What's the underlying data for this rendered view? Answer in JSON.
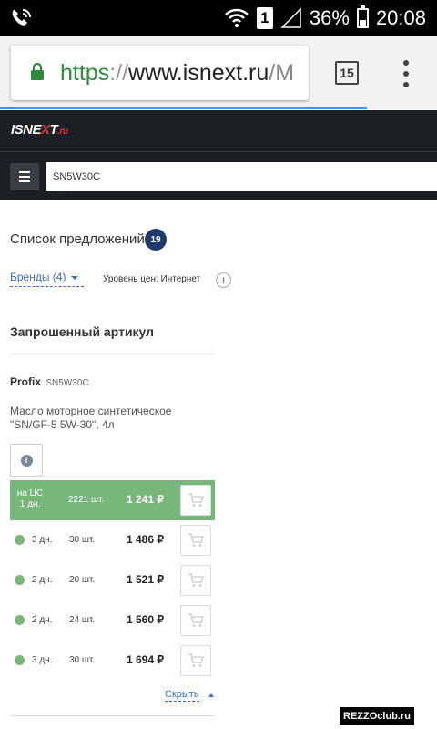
{
  "status_bar": {
    "battery": "36%",
    "time": "20:08",
    "sim_slot": "1",
    "battery_level": 0.36,
    "icons": [
      "phone-wifi-icon",
      "wifi-icon",
      "sim-icon",
      "signal-icon",
      "battery-icon"
    ]
  },
  "browser": {
    "url_scheme": "https",
    "url_separator": "://",
    "url_host": "www.isnext.ru",
    "url_path": "/M",
    "tab_count": "15",
    "accent": "#4a90e2",
    "page_load_progress": 0.84
  },
  "site": {
    "logo_prefix": "ISNE",
    "logo_x": "X",
    "logo_suffix": "T",
    "logo_domain": ".ru",
    "search_value": "SN5W30C"
  },
  "offers": {
    "title": "Список предложений",
    "count": "19",
    "brands_label": "Бренды (4)",
    "price_level": "Уровень цен: Интернет",
    "price_level_info": "!"
  },
  "requested": {
    "title": "Запрошенный артикул",
    "brand": "Profix",
    "article": "SN5W30C",
    "description_line1": "Масло моторное синтетическое",
    "description_line2": "\"SN/GF-5 5W-30\", 4л"
  },
  "rows": [
    {
      "loc_line1": "на ЦС",
      "loc_line2": "1 дн.",
      "qty": "2221 шт.",
      "price": "1 241 ₽"
    },
    {
      "days": "3 дн.",
      "qty": "30 шт.",
      "price": "1 486 ₽"
    },
    {
      "days": "2 дн.",
      "qty": "20 шт.",
      "price": "1 521 ₽"
    },
    {
      "days": "2 дн.",
      "qty": "24 шт.",
      "price": "1 560 ₽"
    },
    {
      "days": "3 дн.",
      "qty": "30 шт.",
      "price": "1 694 ₽"
    }
  ],
  "hide_label": "Скрыть",
  "watermark": "REZZOclub.ru",
  "colors": {
    "header_bg": "#1c1f24",
    "highlight_row": "#77b77a",
    "count_badge": "#1f3a6e",
    "link": "#3f6fb8"
  }
}
